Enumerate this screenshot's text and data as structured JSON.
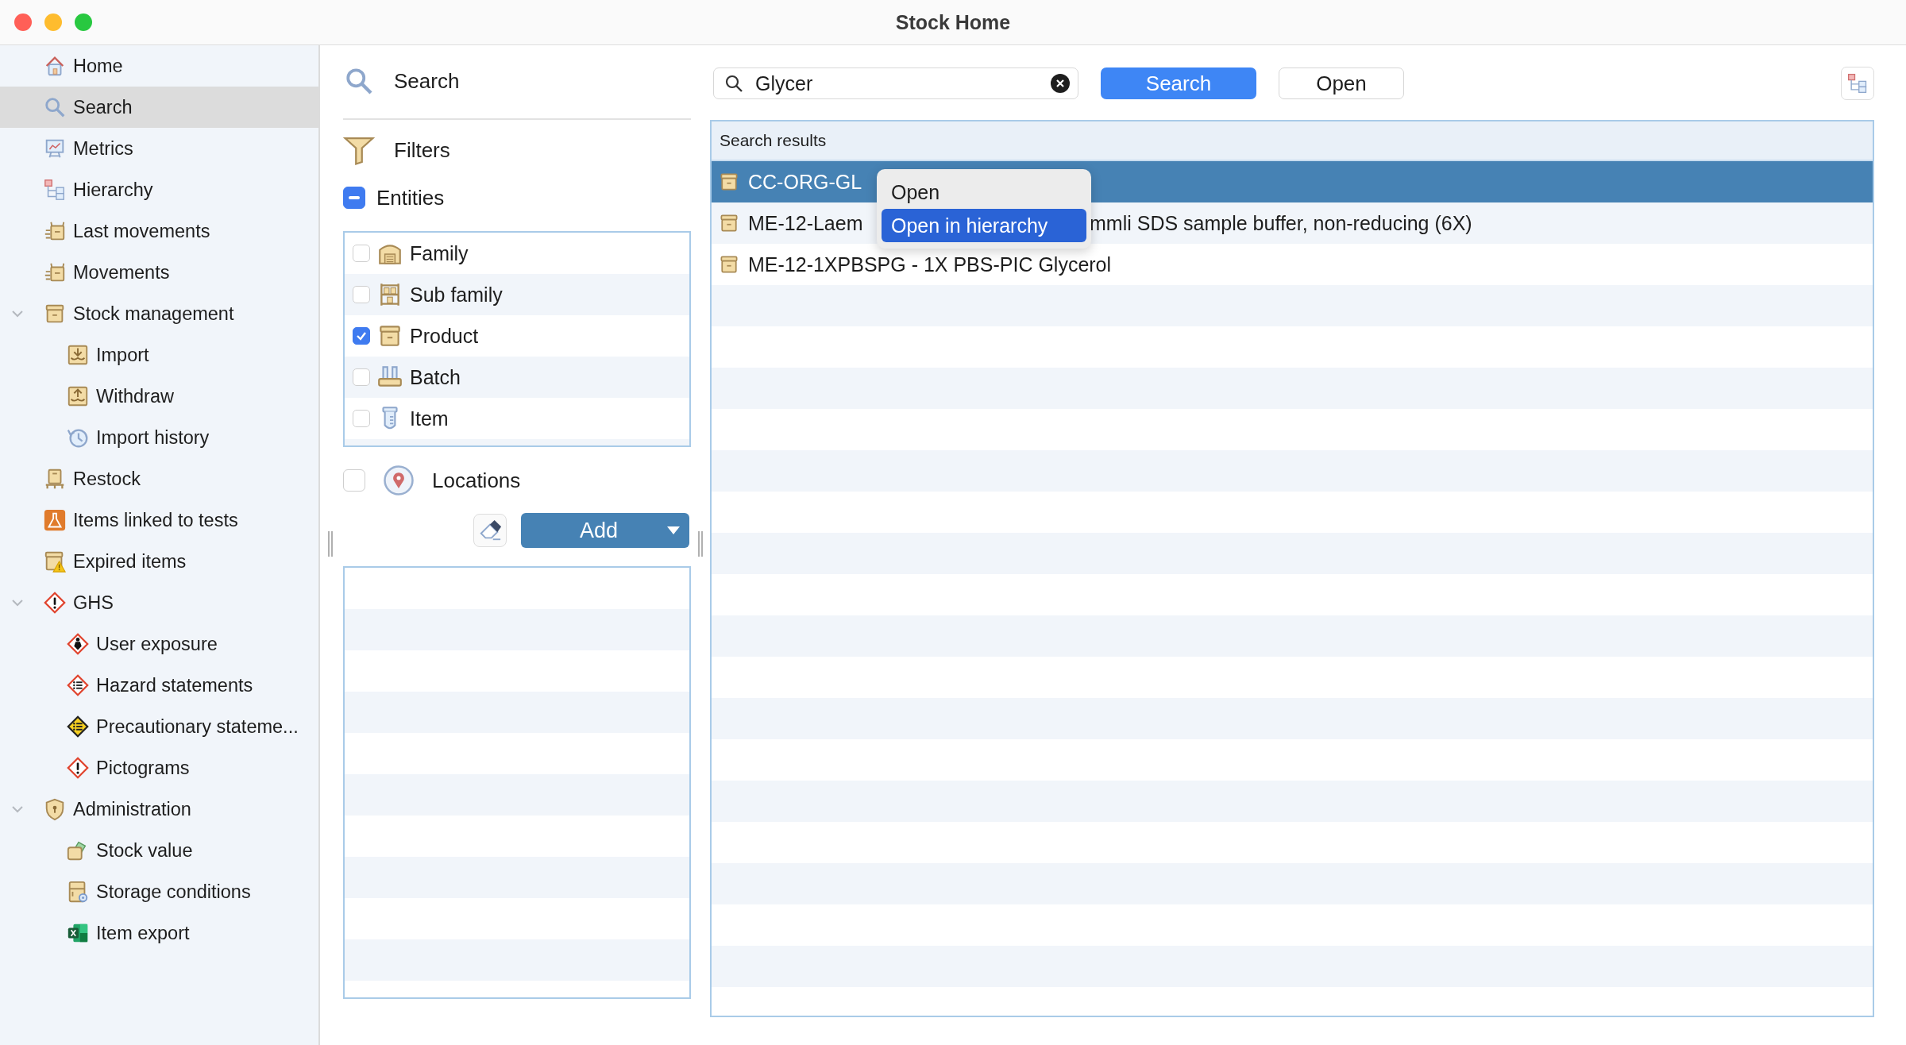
{
  "window": {
    "title": "Stock Home"
  },
  "sidebar": {
    "items": [
      {
        "label": "Home",
        "kind": "home",
        "selected": false
      },
      {
        "label": "Search",
        "kind": "search",
        "selected": true
      },
      {
        "label": "Metrics",
        "kind": "metrics",
        "selected": false
      },
      {
        "label": "Hierarchy",
        "kind": "hierarchy",
        "selected": false
      },
      {
        "label": "Last movements",
        "kind": "movements",
        "selected": false
      },
      {
        "label": "Movements",
        "kind": "movements",
        "selected": false
      },
      {
        "label": "Stock management",
        "kind": "box",
        "selected": false,
        "expanded": true,
        "children": [
          {
            "label": "Import",
            "kind": "import",
            "selected": false
          },
          {
            "label": "Withdraw",
            "kind": "withdraw",
            "selected": false
          },
          {
            "label": "Import history",
            "kind": "history",
            "selected": false
          }
        ]
      },
      {
        "label": "Restock",
        "kind": "restock",
        "selected": false
      },
      {
        "label": "Items linked to tests",
        "kind": "flask",
        "selected": false
      },
      {
        "label": "Expired items",
        "kind": "expired",
        "selected": false
      },
      {
        "label": "GHS",
        "kind": "ghs",
        "selected": false,
        "expanded": true,
        "children": [
          {
            "label": "User exposure",
            "kind": "exposure",
            "selected": false
          },
          {
            "label": "Hazard statements",
            "kind": "hazard",
            "selected": false
          },
          {
            "label": "Precautionary stateme...",
            "kind": "precaution",
            "selected": false
          },
          {
            "label": "Pictograms",
            "kind": "ghs",
            "selected": false
          }
        ]
      },
      {
        "label": "Administration",
        "kind": "shield",
        "selected": false,
        "expanded": true,
        "children": [
          {
            "label": "Stock value",
            "kind": "value",
            "selected": false
          },
          {
            "label": "Storage conditions",
            "kind": "storage",
            "selected": false
          },
          {
            "label": "Item export",
            "kind": "excel",
            "selected": false
          }
        ]
      }
    ]
  },
  "search_panel": {
    "title": "Search",
    "filters_title": "Filters",
    "entities": {
      "label": "Entities",
      "indeterminate": true,
      "items": [
        {
          "label": "Family",
          "kind": "warehouse",
          "checked": false
        },
        {
          "label": "Sub family",
          "kind": "shelf",
          "checked": false
        },
        {
          "label": "Product",
          "kind": "box",
          "checked": true
        },
        {
          "label": "Batch",
          "kind": "batch",
          "checked": false
        },
        {
          "label": "Item",
          "kind": "tube",
          "checked": false
        }
      ]
    },
    "locations": {
      "label": "Locations",
      "checked": false
    },
    "add_button": "Add"
  },
  "search_bar": {
    "value": "Glycer",
    "search_button": "Search",
    "open_button": "Open"
  },
  "results": {
    "header": "Search results",
    "rows": [
      {
        "kind": "box",
        "segments": [
          "CC-ORG-GL"
        ],
        "selected": true
      },
      {
        "kind": "box",
        "segments": [
          "ME-12-Laem",
          "mmli SDS sample buffer, non-reducing (6X)"
        ],
        "selected": false
      },
      {
        "kind": "box",
        "segments": [
          "ME-12-1XPBSPG - 1X PBS-PIC Glycerol"
        ],
        "selected": false
      }
    ]
  },
  "context_menu": {
    "items": [
      {
        "label": "Open",
        "selected": false
      },
      {
        "label": "Open in hierarchy",
        "selected": true
      }
    ]
  }
}
